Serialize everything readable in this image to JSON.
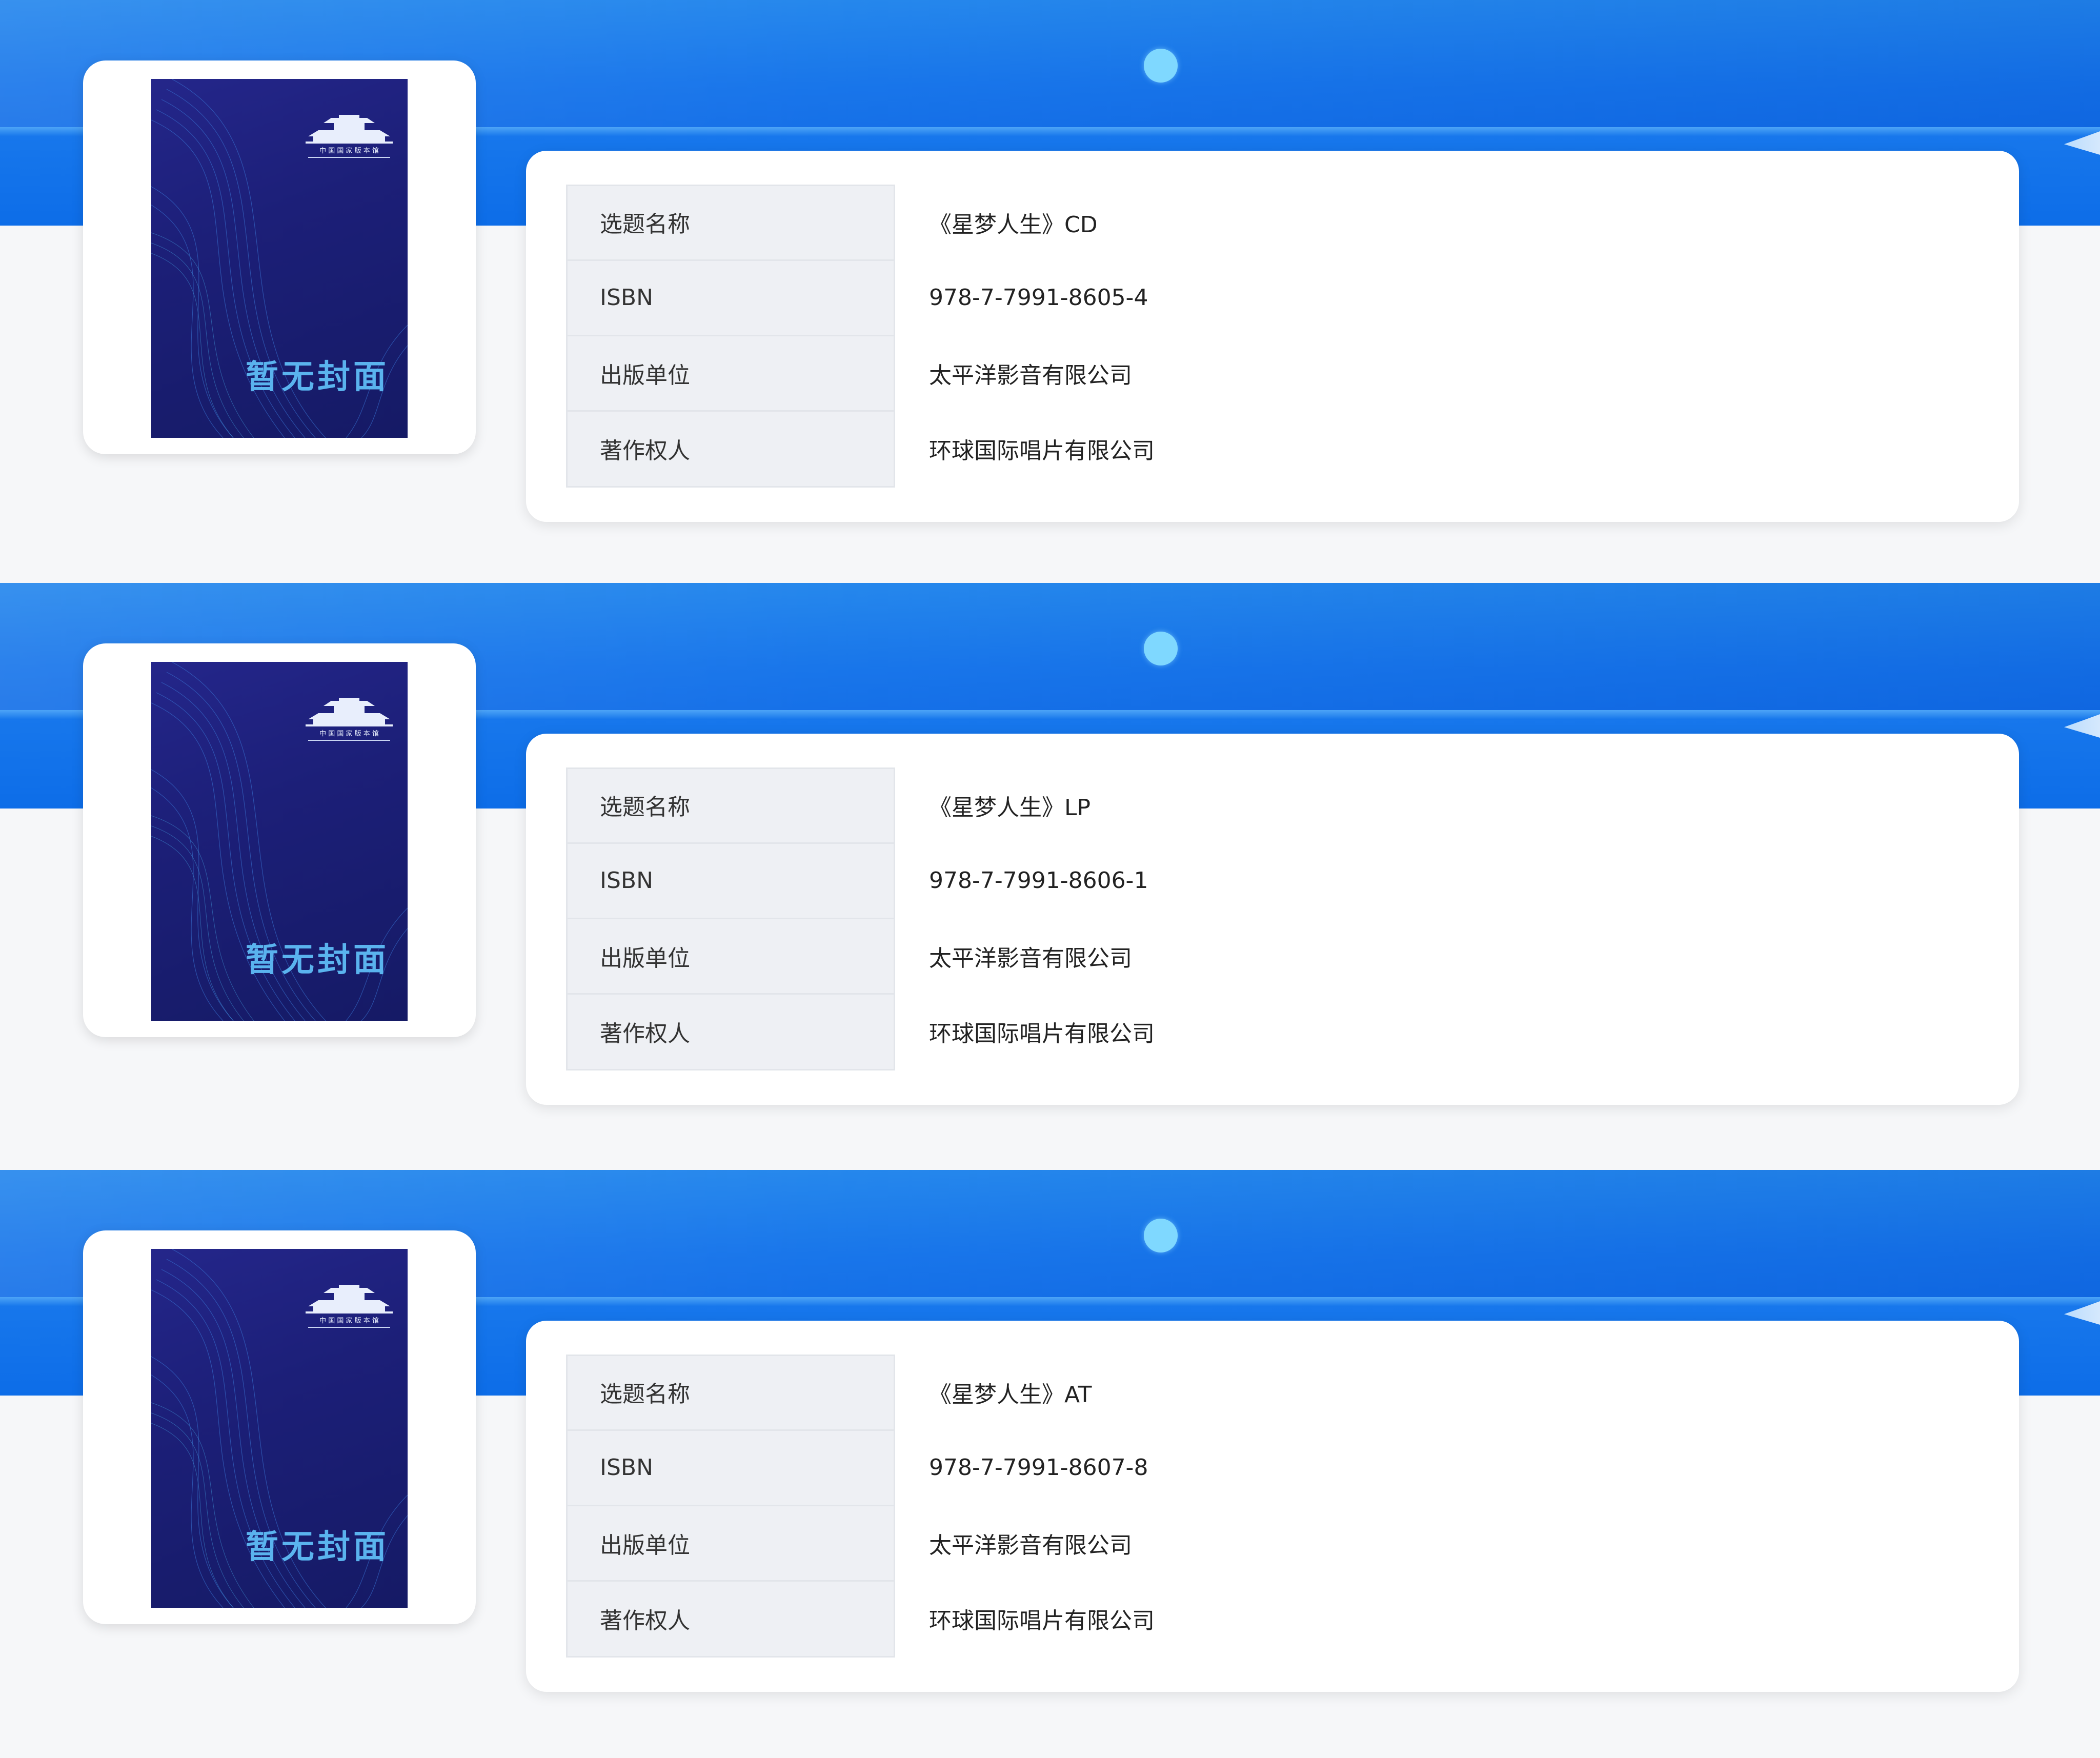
{
  "cover_placeholder_text": "暂无封面",
  "field_labels": {
    "title": "选题名称",
    "isbn": "ISBN",
    "publisher": "出版单位",
    "copyright_holder": "著作权人"
  },
  "records": [
    {
      "title": "《星梦人生》CD",
      "isbn": "978-7-7991-8605-4",
      "publisher": "太平洋影音有限公司",
      "copyright_holder": "环球国际唱片有限公司"
    },
    {
      "title": "《星梦人生》LP",
      "isbn": "978-7-7991-8606-1",
      "publisher": "太平洋影音有限公司",
      "copyright_holder": "环球国际唱片有限公司"
    },
    {
      "title": "《星梦人生》AT",
      "isbn": "978-7-7991-8607-8",
      "publisher": "太平洋影音有限公司",
      "copyright_holder": "环球国际唱片有限公司"
    }
  ],
  "icons": {
    "cover_logo": "building-logo-icon",
    "banner_dot": "dot-decoration"
  },
  "colors": {
    "banner_blue": "#1473ea",
    "label_bg": "#eef0f4",
    "cover_navy": "#1c1f78",
    "cover_text": "#5ab3ee",
    "dot": "#7fd8ff"
  }
}
